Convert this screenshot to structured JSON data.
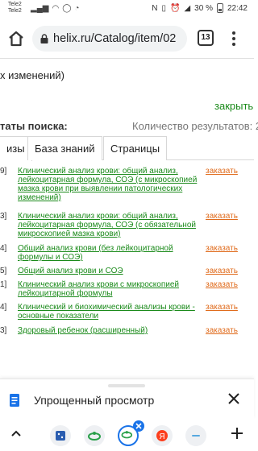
{
  "status_bar": {
    "carrier_1": "Tele2",
    "carrier_2": "Tele2",
    "battery": "30 %",
    "time": "22:42"
  },
  "browser": {
    "url": "helix.ru/Catalog/item/02",
    "tabs_count": "13"
  },
  "page": {
    "fragment_text": "х изменений)",
    "close_label": "закрыть",
    "results_label": "таты поиска:",
    "results_count_label": "Количество результатов: 2",
    "tabs": [
      "изы",
      "База знаний",
      "Страницы"
    ],
    "order_label": "заказать",
    "results": [
      {
        "num": "9]",
        "title": "Клинический анализ крови: общий анализ, лейкоцитарная формула, СОЭ (с микроскопией мазка крови при выявлении патологических изменений)"
      },
      {
        "num": "3]",
        "title": "Клинический анализ крови: общий анализ, лейкоцитарная формула, СОЭ (с обязательной микроскопией мазка крови)"
      },
      {
        "num": "4]",
        "title": "Общий анализ крови (без лейкоцитарной формулы и СОЭ)"
      },
      {
        "num": "5]",
        "title": "Общий анализ крови и СОЭ"
      },
      {
        "num": "1]",
        "title": "Клинический анализ крови с микроскопией лейкоцитарной формулы"
      },
      {
        "num": "4]",
        "title": "Клинический и биохимический анализы крови - основные показатели"
      },
      {
        "num": "3]",
        "title": "Здоровый ребенок (расширенный)"
      }
    ]
  },
  "bottom_sheet": {
    "label": "Упрощенный просмотр"
  },
  "colors": {
    "link_green": "#1a8a1a",
    "order_orange": "#e06b1c",
    "accent_blue": "#1a73e8"
  }
}
